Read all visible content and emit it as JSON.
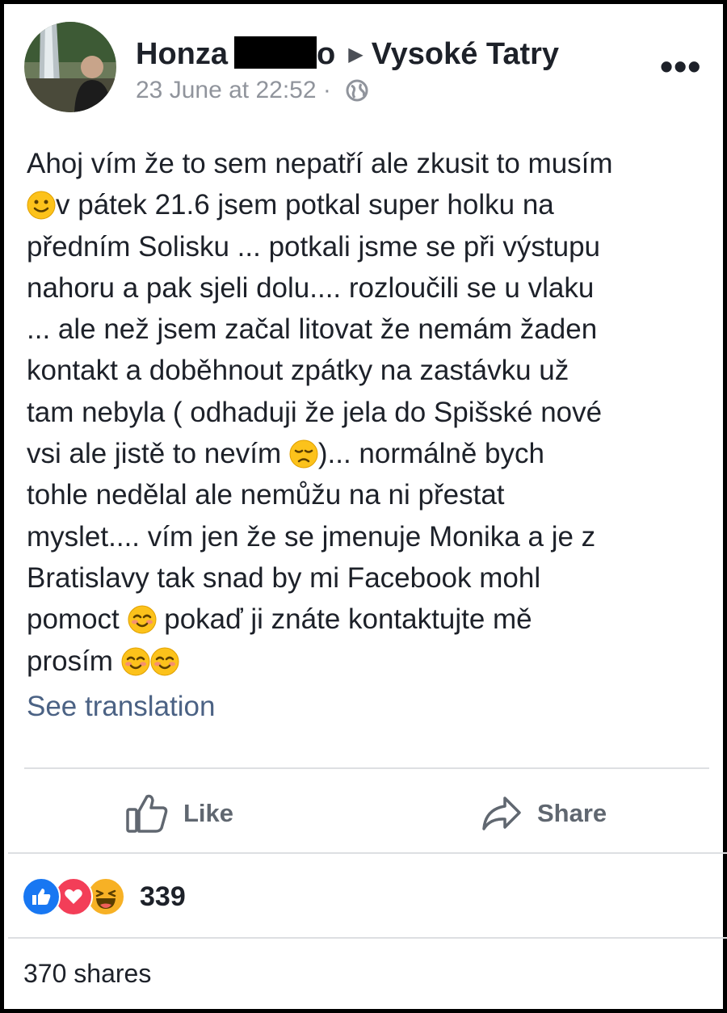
{
  "post": {
    "author": "Honza",
    "author_suffix": "o",
    "target_group": "Vysoké Tatry",
    "timestamp": "23 June at 22:52",
    "meta_separator": "·",
    "privacy_icon": "globe-icon",
    "more_label": "•••",
    "lines": [
      "Ahoj vím že to sem nepatří ale zkusit to musím",
      "v pátek 21.6 jsem potkal super holku na",
      "předním Solisku ... potkali jsme se při výstupu",
      "nahoru a pak sjeli dolu.... rozloučili se u vlaku",
      "... ale než jsem začal litovat že nemám žaden",
      "kontakt a doběhnout zpátky na zastávku už",
      "tam nebyla ( odhaduji že jela do Spišské nové",
      "vsi ale jistě to nevím",
      ")... normálně bych",
      "tohle nedělal ale nemůžu na ni přestat",
      "myslet.... vím jen že se jmenuje Monika a je z",
      "Bratislavy tak snad by mi Facebook mohl",
      "pomoct",
      "pokaď ji znáte kontaktujte mě",
      "prosím"
    ],
    "see_translation": "See translation"
  },
  "actions": {
    "like_label": "Like",
    "share_label": "Share"
  },
  "reactions": {
    "icons": [
      "like-reaction-icon",
      "love-reaction-icon",
      "haha-reaction-icon"
    ],
    "count": "339"
  },
  "shares_text": "370 shares",
  "colors": {
    "text": "#1d2129",
    "meta": "#90949c",
    "link": "#4b6284",
    "like_blue": "#1877f2",
    "love_red": "#f33e58",
    "haha_yellow": "#f7b125"
  }
}
